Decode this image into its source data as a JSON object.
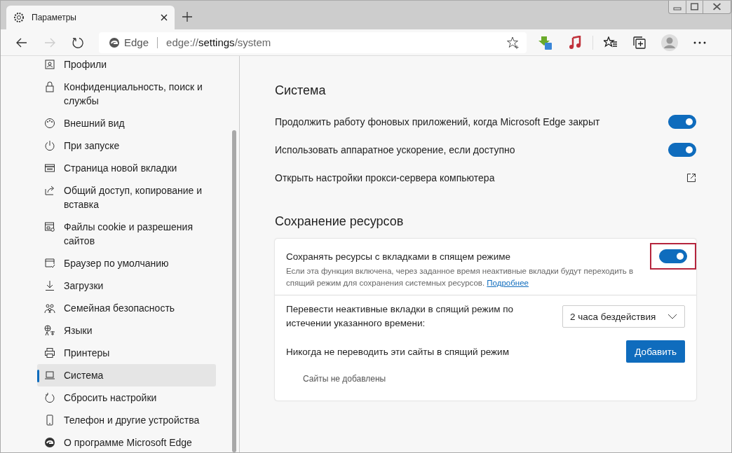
{
  "tab": {
    "title": "Параметры",
    "selected": true
  },
  "address": {
    "brand": "Edge",
    "url_prefix": "edge://",
    "url_main": "settings",
    "url_suffix": "/system"
  },
  "sidebar": {
    "items": [
      {
        "label": "Профили",
        "selected": false
      },
      {
        "label": "Конфиденциальность, поиск и службы",
        "selected": false
      },
      {
        "label": "Внешний вид",
        "selected": false
      },
      {
        "label": "При запуске",
        "selected": false
      },
      {
        "label": "Страница новой вкладки",
        "selected": false
      },
      {
        "label": "Общий доступ, копирование и вставка",
        "selected": false
      },
      {
        "label": "Файлы cookie и разрешения сайтов",
        "selected": false
      },
      {
        "label": "Браузер по умолчанию",
        "selected": false
      },
      {
        "label": "Загрузки",
        "selected": false
      },
      {
        "label": "Семейная безопасность",
        "selected": false
      },
      {
        "label": "Языки",
        "selected": false
      },
      {
        "label": "Принтеры",
        "selected": false
      },
      {
        "label": "Система",
        "selected": true
      },
      {
        "label": "Сбросить настройки",
        "selected": false
      },
      {
        "label": "Телефон и другие устройства",
        "selected": false
      },
      {
        "label": "О программе Microsoft Edge",
        "selected": false
      }
    ]
  },
  "system": {
    "title": "Система",
    "rows": [
      {
        "kind": "toggle",
        "label": "Продолжить работу фоновых приложений, когда Microsoft Edge закрыт",
        "on": true
      },
      {
        "kind": "toggle",
        "label": "Использовать аппаратное ускорение, если доступно",
        "on": true
      },
      {
        "kind": "link",
        "label": "Открыть настройки прокси-сервера компьютера"
      }
    ]
  },
  "resources": {
    "title": "Сохранение ресурсов",
    "sleeping_tabs": {
      "label": "Сохранять ресурсы с вкладками в спящем режиме",
      "on": true,
      "highlighted": true,
      "description": "Если эта функция включена, через заданное время неактивные вкладки будут переходить в спящий режим для сохранения системных ресурсов.",
      "link": "Подробнее"
    },
    "timeout": {
      "label": "Перевести неактивные вкладки в спящий режим по истечении указанного времени:",
      "value": "2 часа бездействия"
    },
    "never": {
      "label": "Никогда не переводить эти сайты в спящий режим",
      "button": "Добавить",
      "empty": "Сайты не добавлены"
    }
  }
}
